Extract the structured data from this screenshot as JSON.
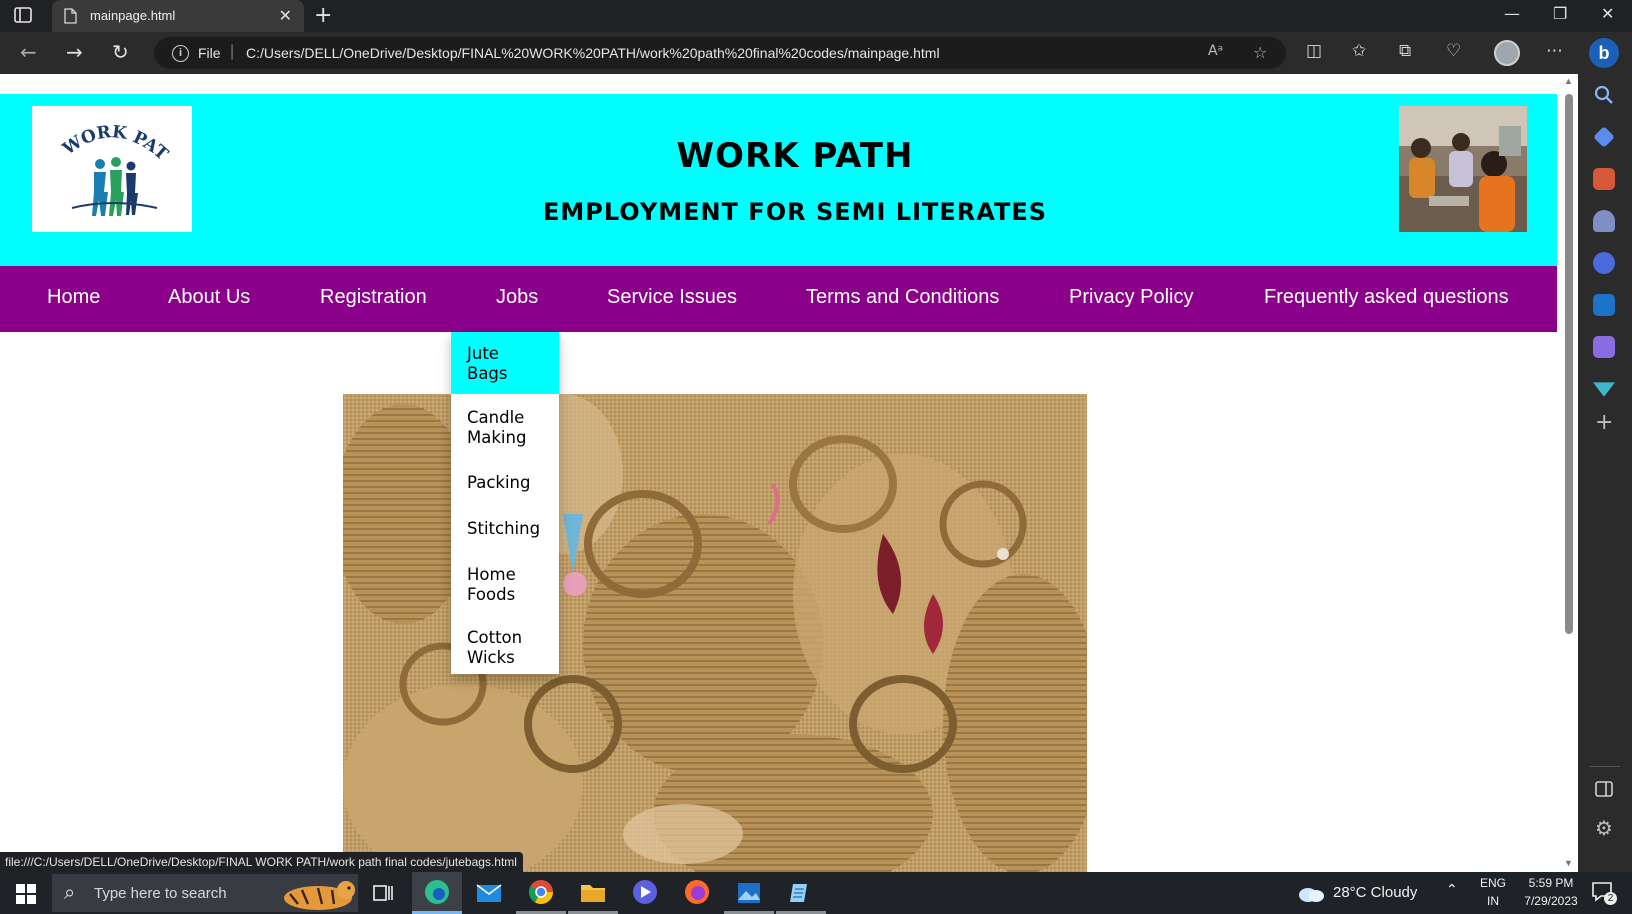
{
  "browser": {
    "tab_title": "mainpage.html",
    "tab_close": "✕",
    "new_tab": "+",
    "scheme_label": "File",
    "url": "C:/Users/DELL/OneDrive/Desktop/FINAL%20WORK%20PATH/work%20path%20final%20codes/mainpage.html",
    "status_url": "file:///C:/Users/DELL/OneDrive/Desktop/FINAL WORK PATH/work path final codes/jutebags.html"
  },
  "site": {
    "title": "WORK PATH",
    "subtitle": "EMPLOYMENT FOR SEMI LITERATES",
    "logo_text": "WORK PATH",
    "colors": {
      "header_bg": "#00ffff",
      "nav_bg": "#8b008b",
      "dropdown_active": "#00ffff"
    }
  },
  "nav": {
    "items": [
      "Home",
      "About Us",
      "Registration",
      "Jobs",
      "Service Issues",
      "Terms and Conditions",
      "Privacy Policy",
      "Frequently asked questions"
    ]
  },
  "jobs_menu": {
    "items": [
      {
        "line1": "Jute",
        "line2": "Bags",
        "active": true
      },
      {
        "line1": "Candle",
        "line2": "Making",
        "active": false
      },
      {
        "line1": "Packing",
        "line2": "",
        "active": false
      },
      {
        "line1": "Stitching",
        "line2": "",
        "active": false
      },
      {
        "line1": "Home",
        "line2": "Foods",
        "active": false
      },
      {
        "line1": "Cotton",
        "line2": "Wicks",
        "active": false
      }
    ]
  },
  "taskbar": {
    "search_placeholder": "Type here to search",
    "weather": "28°C  Cloudy",
    "language": "ENG",
    "region": "IN",
    "time": "5:59 PM",
    "date": "7/29/2023",
    "notifications": "2"
  }
}
